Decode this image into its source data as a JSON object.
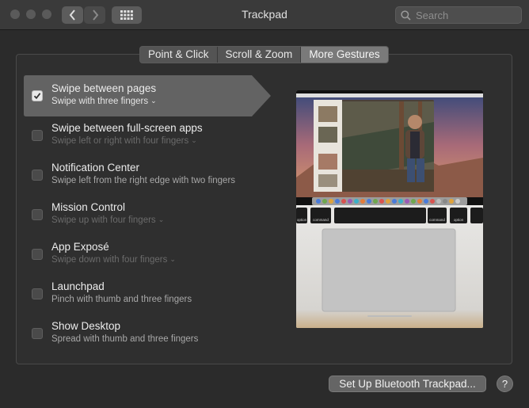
{
  "window": {
    "title": "Trackpad"
  },
  "toolbar": {
    "back_icon": "chevron-left-icon",
    "forward_icon": "chevron-right-icon",
    "show_all_icon": "grid-icon",
    "search_placeholder": "Search",
    "search_value": ""
  },
  "tabs": [
    {
      "label": "Point & Click",
      "active": false
    },
    {
      "label": "Scroll & Zoom",
      "active": false
    },
    {
      "label": "More Gestures",
      "active": true
    }
  ],
  "gestures": [
    {
      "title": "Swipe between pages",
      "subtitle": "Swipe with three fingers",
      "checked": true,
      "selected": true,
      "has_menu": true,
      "dimmed": false
    },
    {
      "title": "Swipe between full-screen apps",
      "subtitle": "Swipe left or right with four fingers",
      "checked": false,
      "selected": false,
      "has_menu": true,
      "dimmed": true
    },
    {
      "title": "Notification Center",
      "subtitle": "Swipe left from the right edge with two fingers",
      "checked": false,
      "selected": false,
      "has_menu": false,
      "dimmed": false
    },
    {
      "title": "Mission Control",
      "subtitle": "Swipe up with four fingers",
      "checked": false,
      "selected": false,
      "has_menu": true,
      "dimmed": true
    },
    {
      "title": "App Exposé",
      "subtitle": "Swipe down with four fingers",
      "checked": false,
      "selected": false,
      "has_menu": true,
      "dimmed": true
    },
    {
      "title": "Launchpad",
      "subtitle": "Pinch with thumb and three fingers",
      "checked": false,
      "selected": false,
      "has_menu": false,
      "dimmed": false
    },
    {
      "title": "Show Desktop",
      "subtitle": "Spread with thumb and three fingers",
      "checked": false,
      "selected": false,
      "has_menu": false,
      "dimmed": false
    }
  ],
  "preview": {
    "keys": [
      "command",
      "option",
      "command",
      "option"
    ]
  },
  "footer": {
    "setup_label": "Set Up Bluetooth Trackpad...",
    "help_label": "?"
  },
  "colors": {
    "background": "#2b2b2b",
    "titlebar": "#3a3a3a",
    "selection": "#636363"
  }
}
